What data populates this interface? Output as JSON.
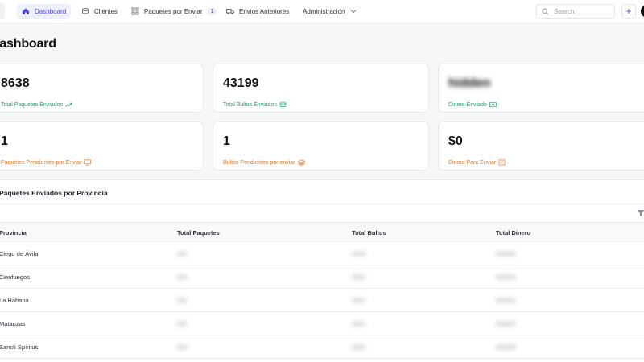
{
  "nav": {
    "items": [
      {
        "label": "Dashboard",
        "icon": "home-icon",
        "active": true
      },
      {
        "label": "Clientes",
        "icon": "users-icon"
      },
      {
        "label": "Paquetes por Enviar",
        "icon": "packages-icon",
        "badge": "1"
      },
      {
        "label": "Envios Anteriores",
        "icon": "truck-icon"
      },
      {
        "label": "Administración",
        "icon": "chevron-down-icon"
      }
    ],
    "search_placeholder": "Search",
    "plus": "+"
  },
  "page": {
    "title": "Dashboard"
  },
  "stats": [
    {
      "value": "8638",
      "label": "Total Paquetes Enviados",
      "icon": "trend-up-icon",
      "color": "#22a06b"
    },
    {
      "value": "43199",
      "label": "Total Bultos Enviados",
      "icon": "database-icon",
      "color": "#22a06b"
    },
    {
      "value": "hidden",
      "label": "Dinero Enviado",
      "icon": "cash-icon",
      "color": "#22a06b"
    },
    {
      "value": "1",
      "label": "Paquetes Pendientes por Enviar",
      "icon": "monitor-icon",
      "color": "#e0782b"
    },
    {
      "value": "1",
      "label": "Bultos Pendientes por enviar",
      "icon": "layers-icon",
      "color": "#e0782b"
    },
    {
      "value": "$0",
      "label": "Dinero Para Enviar",
      "icon": "receipt-icon",
      "color": "#e0782b"
    }
  ],
  "table": {
    "title": "Paquetes Enviados por Provincia",
    "columns": [
      "Provincia",
      "Total Paquetes",
      "Total Bultos",
      "Total Dinero"
    ],
    "rows": [
      [
        "Ciego de Ávila",
        "000",
        "0000",
        "000000"
      ],
      [
        "Cienfuegos",
        "000",
        "0000",
        "000000"
      ],
      [
        "La Habana",
        "000",
        "0000",
        "000000"
      ],
      [
        "Matanzas",
        "000",
        "0000",
        "000000"
      ],
      [
        "Sancti Spíritus",
        "000",
        "0000",
        "000000"
      ]
    ]
  },
  "colors": {
    "accent": "#4f46e5",
    "positive": "#22a06b",
    "pending": "#e0782b"
  }
}
